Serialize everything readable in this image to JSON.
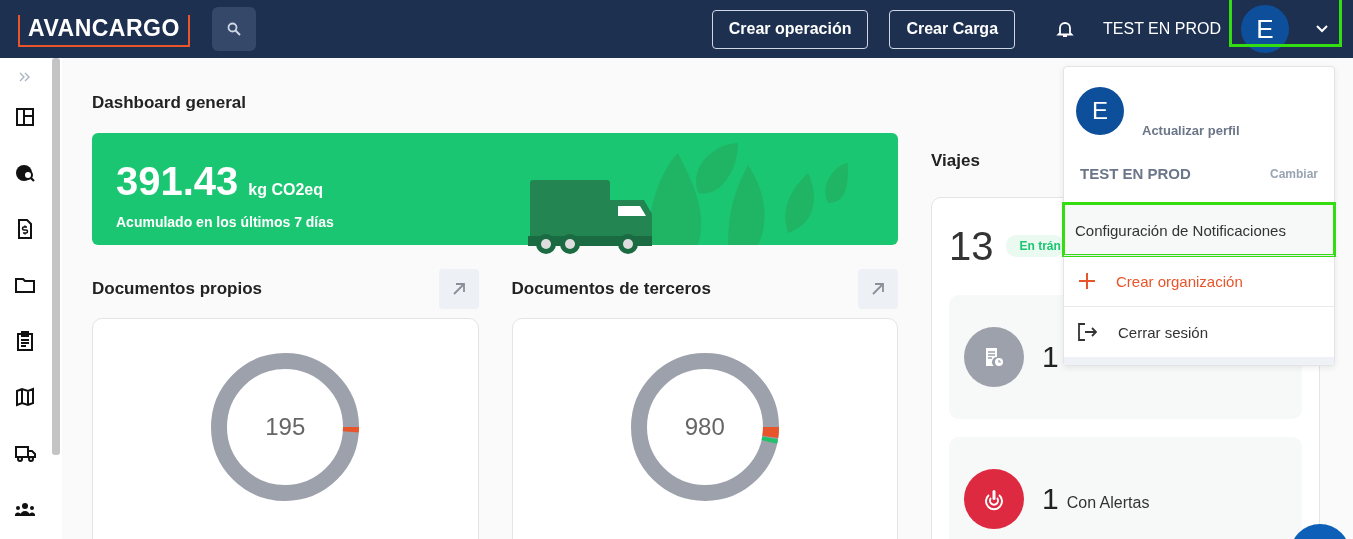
{
  "header": {
    "logo": "AVANCARGO",
    "buttons": [
      {
        "label": "Crear operación"
      },
      {
        "label": "Crear Carga"
      }
    ],
    "organization": "TEST EN PROD",
    "avatar": {
      "initial": "E",
      "highlighted": true
    }
  },
  "page": {
    "title": "Dashboard general"
  },
  "emissions": {
    "value": "391.43",
    "unit": "kg CO2eq",
    "caption": "Acumulado en los últimos 7 días"
  },
  "documents": [
    {
      "title": "Documentos propios",
      "total": "195"
    },
    {
      "title": "Documentos de terceros",
      "total": "980"
    }
  ],
  "trips": {
    "title": "Viajes",
    "count": "13",
    "status": "En trán",
    "stats": [
      {
        "kind": "scheduled",
        "count": "1"
      },
      {
        "kind": "alerts",
        "count": "1",
        "label": "Con Alertas"
      }
    ]
  },
  "profile_menu": {
    "avatar_initial": "E",
    "update_profile": "Actualizar perfil",
    "organization": "TEST EN PROD",
    "change": "Cambiar",
    "items": [
      {
        "kind": "settings",
        "label": "Configuración de Notificaciones",
        "highlighted": true
      },
      {
        "kind": "create",
        "label": "Crear organización",
        "highlighted": false
      },
      {
        "kind": "logout",
        "label": "Cerrar sesión",
        "highlighted": false
      }
    ]
  }
}
